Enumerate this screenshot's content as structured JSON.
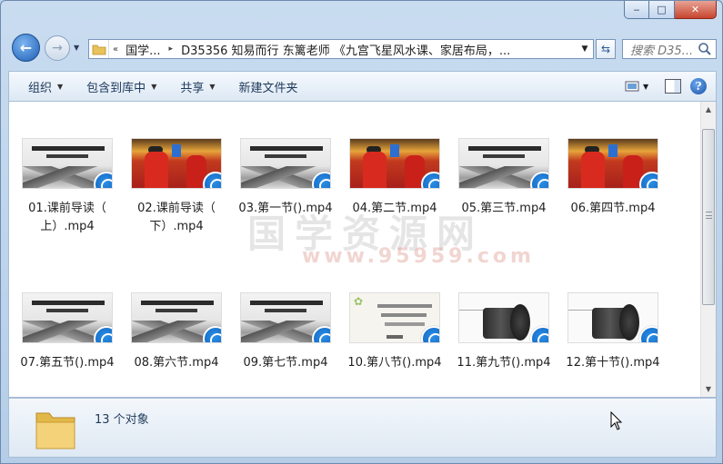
{
  "window": {
    "caption_min": "‒",
    "caption_max": "□",
    "caption_close": "✕"
  },
  "nav": {
    "back_glyph": "←",
    "forward_glyph": "→",
    "dropdown_glyph": "▼"
  },
  "address": {
    "chevron": "«",
    "segments": [
      "国学...",
      "D35356 知易而行 东篱老师 《九宫飞星风水课、家居布局，..."
    ],
    "separator": "▸"
  },
  "search": {
    "placeholder": "搜索 D35..."
  },
  "toolbar": {
    "organize_label": "组织",
    "include_library_label": "包含到库中",
    "share_label": "共享",
    "new_folder_label": "新建文件夹"
  },
  "files": [
    {
      "name_line1": "01.课前导读（",
      "name_line2": "上）.mp4",
      "thumb": "ink"
    },
    {
      "name_line1": "02.课前导读（",
      "name_line2": "下）.mp4",
      "thumb": "temple"
    },
    {
      "name_line1": "03.第一节().mp4",
      "name_line2": "",
      "thumb": "ink"
    },
    {
      "name_line1": "04.第二节.mp4",
      "name_line2": "",
      "thumb": "temple"
    },
    {
      "name_line1": "05.第三节.mp4",
      "name_line2": "",
      "thumb": "ink"
    },
    {
      "name_line1": "06.第四节.mp4",
      "name_line2": "",
      "thumb": "temple"
    },
    {
      "name_line1": "07.第五节().mp4",
      "name_line2": "",
      "thumb": "ink"
    },
    {
      "name_line1": "08.第六节.mp4",
      "name_line2": "",
      "thumb": "ink"
    },
    {
      "name_line1": "09.第七节.mp4",
      "name_line2": "",
      "thumb": "ink"
    },
    {
      "name_line1": "10.第八节().mp4",
      "name_line2": "",
      "thumb": "slide"
    },
    {
      "name_line1": "11.第九节().mp4",
      "name_line2": "",
      "thumb": "roll"
    },
    {
      "name_line1": "12.第十节().mp4",
      "name_line2": "",
      "thumb": "roll"
    }
  ],
  "watermark": {
    "main": "国学资源网",
    "sub": "www.95959.com"
  },
  "status": {
    "count_text": "13 个对象"
  },
  "colors": {
    "accent": "#1e395b",
    "badge": "#0b5bb8"
  }
}
